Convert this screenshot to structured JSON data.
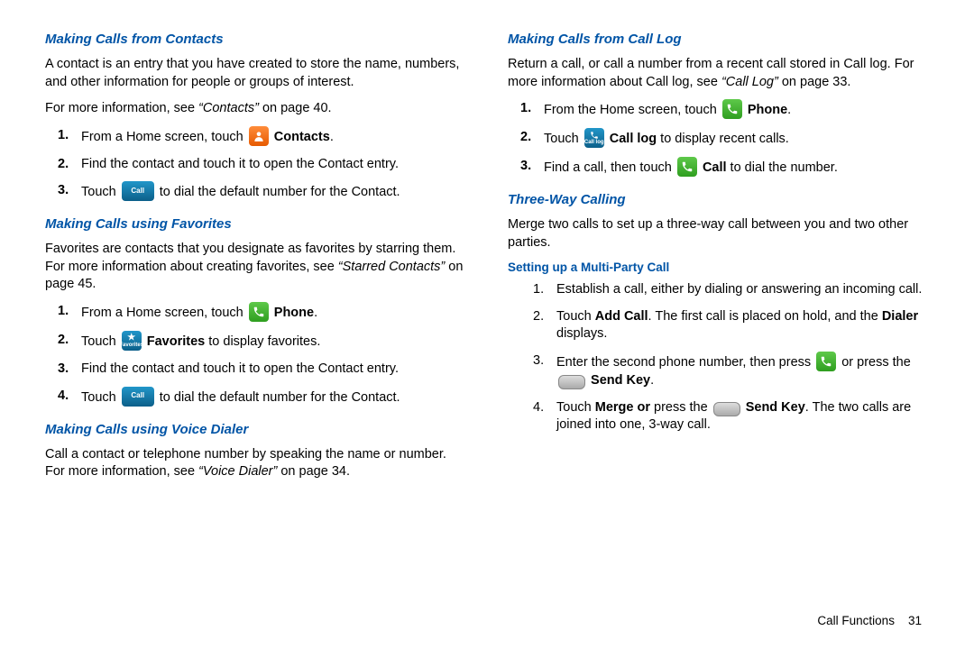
{
  "left": {
    "sec1": {
      "heading": "Making Calls from Contacts",
      "para1": "A contact is an entry that you have created to store the name, numbers, and other information for people or groups of interest.",
      "para2a": "For more information, see ",
      "para2_ref": "“Contacts”",
      "para2b": " on page 40.",
      "step1a": "From a Home screen, touch ",
      "step1b": "Contacts",
      "step1c": ".",
      "step2": "Find the contact and touch it to open the Contact entry.",
      "step3a": "Touch ",
      "step3b": " to dial the default number for the Contact."
    },
    "sec2": {
      "heading": "Making Calls using Favorites",
      "para1a": "Favorites are contacts that you designate as favorites by starring them. For more information about creating favorites, see ",
      "para1_ref": "“Starred Contacts”",
      "para1b": " on page 45.",
      "step1a": "From a Home screen, touch ",
      "step1b": "Phone",
      "step1c": ".",
      "step2a": "Touch ",
      "step2b": "Favorites",
      "step2c": " to display favorites.",
      "step3": "Find the contact and touch it to open the Contact entry.",
      "step4a": "Touch ",
      "step4b": " to dial the default number for the Contact."
    },
    "sec3": {
      "heading": "Making Calls using Voice Dialer",
      "para1a": "Call a contact or telephone number by speaking the name or number. For more information, see ",
      "para1_ref": "“Voice Dialer”",
      "para1b": " on page 34."
    }
  },
  "right": {
    "sec1": {
      "heading": "Making Calls from Call Log",
      "para1a": "Return a call, or call a number from a recent call stored in Call log. For more information about Call log, see ",
      "para1_ref": "“Call Log”",
      "para1b": " on page 33.",
      "step1a": "From the Home screen, touch ",
      "step1b": "Phone",
      "step1c": ".",
      "step2a": "Touch ",
      "step2b": "Call log",
      "step2c": " to display recent calls.",
      "step3a": "Find a call, then touch ",
      "step3b": "Call",
      "step3c": " to dial the number."
    },
    "sec2": {
      "heading": "Three-Way Calling",
      "para1": "Merge two calls to set up a three-way call between you and two other parties.",
      "sub_heading": "Setting up a Multi-Party Call",
      "step1": "Establish a call, either by dialing or answering an incoming call.",
      "step2a": "Touch ",
      "step2b": "Add Call",
      "step2c": ". The first call is placed on hold, and the ",
      "step2d": "Dialer",
      "step2e": " displays.",
      "step3a": "Enter the second phone number, then press ",
      "step3b": " or press the ",
      "step3c": "Send Key",
      "step3d": ".",
      "step4a": "Touch ",
      "step4b": "Merge or ",
      "step4c": "press the ",
      "step4d": "Send Key",
      "step4e": ". The two calls are joined into one, 3-way call."
    }
  },
  "footer": {
    "section": "Call Functions",
    "page": "31"
  },
  "icons": {
    "call_label": "Call",
    "favorites_label": "Favorites",
    "calllog_label": "Call log"
  }
}
